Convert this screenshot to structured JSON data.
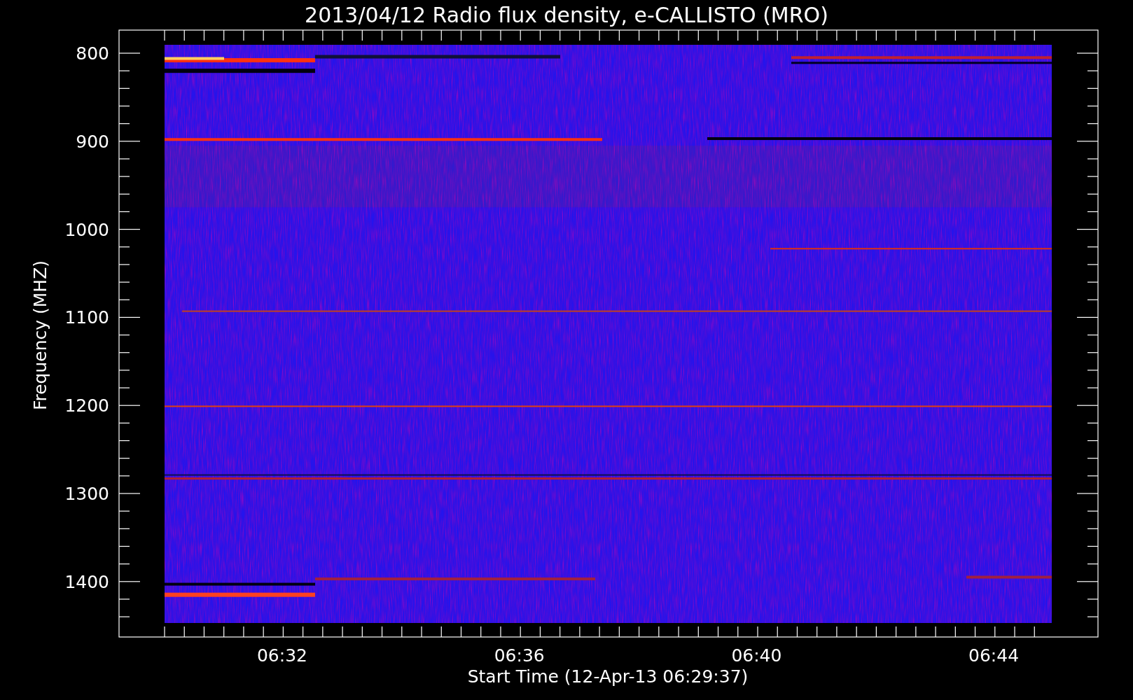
{
  "title": "2013/04/12  Radio flux density, e-CALLISTO (MRO)",
  "y_axis": {
    "label": "Frequency (MHZ)",
    "ticks": [
      "800",
      "900",
      "1000",
      "1100",
      "1200",
      "1300",
      "1400"
    ]
  },
  "x_axis": {
    "label": "Start Time (12-Apr-13 06:29:37)",
    "ticks": [
      "06:32",
      "06:36",
      "06:40",
      "06:44"
    ]
  }
}
